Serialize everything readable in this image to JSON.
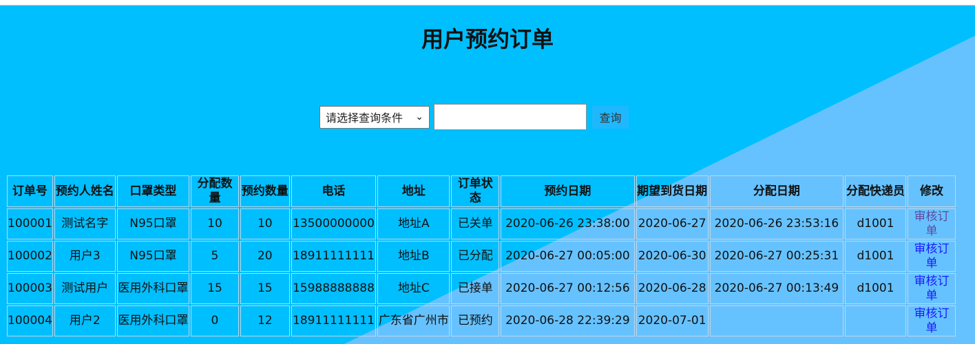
{
  "page": {
    "title": "用户预约订单"
  },
  "search": {
    "selected": "请选择查询条件",
    "value": "",
    "button_label": "查询"
  },
  "table": {
    "headers": [
      "订单号",
      "预约人姓名",
      "口罩类型",
      "分配数量",
      "预约数量",
      "电话",
      "地址",
      "订单状态",
      "预约日期",
      "期望到货日期",
      "分配日期",
      "分配快递员",
      "修改"
    ],
    "rows": [
      {
        "order_id": "100001",
        "name": "测试名字",
        "mask_type": "N95口罩",
        "allocated_qty": "10",
        "reserved_qty": "10",
        "phone": "13500000000",
        "address": "地址A",
        "status": "已关单",
        "reserve_date": "2020-06-26 23:38:00",
        "expected_date": "2020-06-27",
        "allocated_date": "2020-06-26 23:53:16",
        "courier": "d1001",
        "action": "审核订单"
      },
      {
        "order_id": "100002",
        "name": "用户3",
        "mask_type": "N95口罩",
        "allocated_qty": "5",
        "reserved_qty": "20",
        "phone": "18911111111",
        "address": "地址B",
        "status": "已分配",
        "reserve_date": "2020-06-27 00:05:00",
        "expected_date": "2020-06-30",
        "allocated_date": "2020-06-27 00:25:31",
        "courier": "d1001",
        "action": "审核订单"
      },
      {
        "order_id": "100003",
        "name": "测试用户",
        "mask_type": "医用外科口罩",
        "allocated_qty": "15",
        "reserved_qty": "15",
        "phone": "15988888888",
        "address": "地址C",
        "status": "已接单",
        "reserve_date": "2020-06-27 00:12:56",
        "expected_date": "2020-06-28",
        "allocated_date": "2020-06-27 00:13:49",
        "courier": "d1001",
        "action": "审核订单"
      },
      {
        "order_id": "100004",
        "name": "用户2",
        "mask_type": "医用外科口罩",
        "allocated_qty": "0",
        "reserved_qty": "12",
        "phone": "18911111111",
        "address": "广东省广州市",
        "status": "已预约",
        "reserve_date": "2020-06-28 22:39:29",
        "expected_date": "2020-07-01",
        "allocated_date": "",
        "courier": "",
        "action": "审核订单"
      }
    ]
  },
  "colors": {
    "background": "#00bfff",
    "diagonal": "#66c2ff",
    "link": "#1a1aff",
    "visited_link": "#5e49a1"
  }
}
